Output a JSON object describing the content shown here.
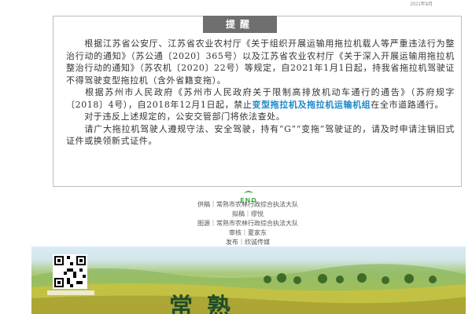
{
  "header": {
    "date": "2021年8月"
  },
  "notice": {
    "title": "提醒",
    "p1": "根据江苏省公安厅、江苏省农业农村厅《关于组织开展运输用拖拉机载人等严重违法行为整治行动的通知》（苏公通〔2020〕365号）以及江苏省农业农村厅《关于深入开展运输用拖拉机整治行动的通知》（苏农机〔2020〕22号）等规定，自2021年1月1日起，持我省拖拉机驾驶证不得驾驶变型拖拉机（含外省籍变拖）。",
    "p2_before": "根据苏州市人民政府《苏州市人民政府关于限制高排放机动车通行的通告》（苏府规字〔2018〕4号），自2018年12月1日起，禁止",
    "p2_highlight": "变型拖拉机及拖拉机运输机组",
    "p2_after": "在全市道路通行。",
    "p3": "对于违反上述规定的，公安交管部门将依法查处。",
    "p4": "请广大拖拉机驾驶人遵规守法、安全驾驶，持有“G”“变拖”驾驶证的，请及时申请注销旧式证件或换领新式证件。"
  },
  "end_mark": {
    "text": "END"
  },
  "credits": [
    "供稿｜常熟市农林行政综合执法大队",
    "拟稿｜缪悦",
    "图源｜常熟市农林行政综合执法大队",
    "审核｜夏家东",
    "发布｜欣诚传媒"
  ],
  "banner": {
    "calligraphy": "常熟"
  },
  "colors": {
    "highlight": "#1e88c8",
    "title_bg": "#6f6f6f",
    "end_green": "#4caf50"
  }
}
